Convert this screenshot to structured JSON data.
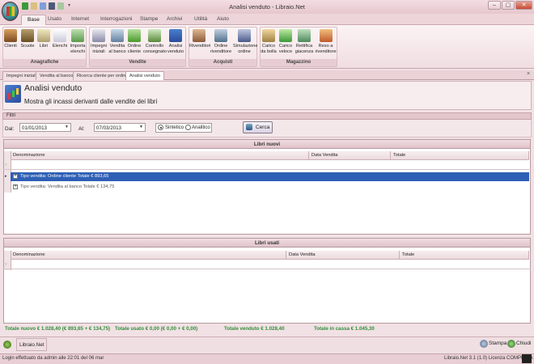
{
  "window": {
    "title": "Analisi venduto - Libraio.Net",
    "controls": [
      "–",
      "▢",
      "✕"
    ]
  },
  "ribbon": {
    "tabs": [
      "Base",
      "Usato",
      "Internet",
      "Interrogazioni",
      "Stampe",
      "Archivi",
      "Utilità",
      "Aiuto"
    ],
    "active_tab": "Base",
    "groups": [
      {
        "label": "Anagrafiche",
        "buttons": [
          "Clienti",
          "Scuole",
          "Libri",
          "Elenchi",
          "Importa elenchi"
        ]
      },
      {
        "label": "Vendite",
        "buttons": [
          "Impegni iniziali",
          "Vendita al banco",
          "Ordine cliente",
          "Controllo consegnato",
          "Analisi venduto"
        ]
      },
      {
        "label": "Acquisti",
        "buttons": [
          "Rivenditori",
          "Ordine rivenditore",
          "Simulazione ordine"
        ]
      },
      {
        "label": "Magazzino",
        "buttons": [
          "Carico da bolla",
          "Carico veloce",
          "Rettifica giacenza",
          "Reso a rivenditore"
        ]
      }
    ]
  },
  "doc_tabs": [
    "Impegni iniziali",
    "Vendita al banco",
    "Ricerca cliente per ordini",
    "Analisi venduto"
  ],
  "doc_close": "×",
  "header": {
    "title": "Analisi venduto",
    "subtitle": "Mostra gli incassi derivanti dalle vendite dei libri"
  },
  "filters": {
    "section_label": "Filtri",
    "from_label": "Dal:",
    "from_value": "01/01/2013",
    "to_label": "Al:",
    "to_value": "07/03/2013",
    "mode_options": [
      "Sintetico",
      "Analitico"
    ],
    "mode_selected": "Sintetico",
    "search_label": "Cerca"
  },
  "grid_new": {
    "title": "Libri nuovi",
    "columns": [
      "Denominazione",
      "Data Vendita",
      "Totale"
    ],
    "rows": [
      {
        "label": "Tipo vendita: Ordine cliente Totale € 893,65",
        "selected": true
      },
      {
        "label": "Tipo vendita: Vendita al banco Totale € 134,75",
        "selected": false
      }
    ]
  },
  "grid_used": {
    "title": "Libri usati",
    "columns": [
      "Denominazione",
      "Data Vendita",
      "Totale"
    ]
  },
  "totals": {
    "new": "Totale nuovo € 1.028,40 (€ 893,65 + € 134,75)",
    "used": "Totale usato € 0,00 (€ 0,00 + € 0,00)",
    "sold": "Totale venduto € 1.028,40",
    "cash": "Totale in cassa € 1.045,30"
  },
  "footer": {
    "brand": "Libraio.Net",
    "print_label": "Stampa",
    "close_label": "Chiudi"
  },
  "status": {
    "left": "Login effettuato da admin alle 22:01 del 06 mar",
    "right": "Libraio.Net 3.1 (1.0) Licenza COMPLETA"
  }
}
